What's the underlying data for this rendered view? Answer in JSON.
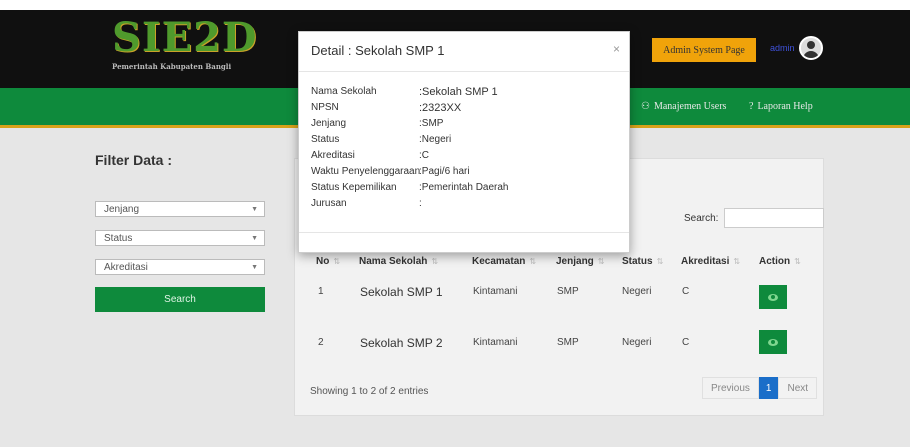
{
  "header": {
    "logo_text": "SIE2D",
    "logo_subtext": "Pemerintah Kabupaten Bangli",
    "admin_button": "Admin System Page",
    "user_name": "admin"
  },
  "nav": {
    "items": [
      {
        "label": "Manajemen Users",
        "icon": "users-icon"
      },
      {
        "label": "Laporan Help",
        "icon": "question-icon"
      }
    ]
  },
  "filter": {
    "title": "Filter Data :",
    "selects": [
      {
        "value": "Jenjang"
      },
      {
        "value": "Status"
      },
      {
        "value": "Akreditasi"
      }
    ],
    "search_button": "Search"
  },
  "table": {
    "search_label": "Search:",
    "columns": [
      "No",
      "Nama Sekolah",
      "Kecamatan",
      "Jenjang",
      "Status",
      "Akreditasi",
      "Action"
    ],
    "rows": [
      {
        "no": "1",
        "nama": "Sekolah SMP 1",
        "kecamatan": "Kintamani",
        "jenjang": "SMP",
        "status": "Negeri",
        "akreditasi": "C"
      },
      {
        "no": "2",
        "nama": "Sekolah SMP 2",
        "kecamatan": "Kintamani",
        "jenjang": "SMP",
        "status": "Negeri",
        "akreditasi": "C"
      }
    ],
    "info": "Showing 1 to 2 of 2 entries",
    "pagination": {
      "previous": "Previous",
      "current": "1",
      "next": "Next"
    }
  },
  "modal": {
    "title": "Detail : Sekolah SMP 1",
    "close": "×",
    "fields": [
      {
        "key": "Nama Sekolah",
        "value": ":Sekolah SMP 1"
      },
      {
        "key": "NPSN",
        "value": ":2323XX"
      },
      {
        "key": "Jenjang",
        "value": ":SMP"
      },
      {
        "key": "Status",
        "value": ":Negeri"
      },
      {
        "key": "Akreditasi",
        "value": ":C"
      },
      {
        "key": "Waktu Penyelenggaraan",
        "value": ":Pagi/6 hari"
      },
      {
        "key": "Status Kepemilikan",
        "value": ":Pemerintah Daerah"
      },
      {
        "key": "Jurusan",
        "value": ":"
      }
    ]
  },
  "colors": {
    "topbar": "#101010",
    "navbar": "#0e8a3c",
    "accent": "#f0a30a",
    "pagination_active": "#1a6ec9"
  }
}
